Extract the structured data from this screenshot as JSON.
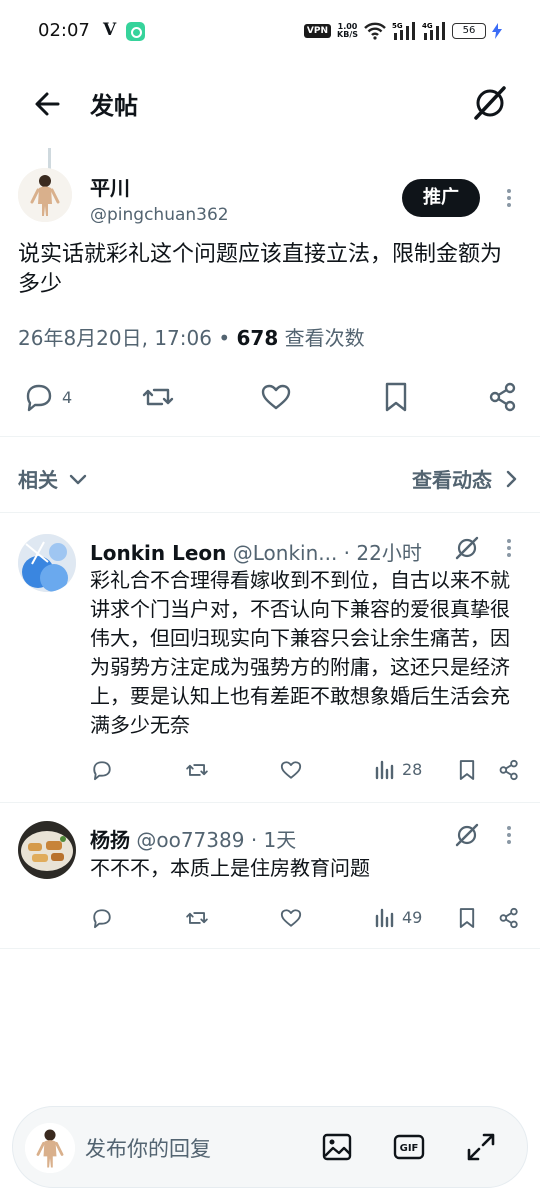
{
  "status_bar": {
    "time": "02:07",
    "carrier_mark": "V",
    "vpn": "VPN",
    "speed_value": "1.00",
    "speed_unit": "KB/S",
    "signal_1": "5G",
    "signal_2": "4G",
    "battery": "56"
  },
  "header": {
    "title": "发帖"
  },
  "post": {
    "author_name": "平川",
    "author_handle": "@pingchuan362",
    "promote_label": "推广",
    "text": "说实话就彩礼这个问题应该直接立法，限制金额为多少",
    "date": "26年8月20日, 17:06",
    "separator": " • ",
    "views": "678",
    "views_label": " 查看次数",
    "reply_count": "4"
  },
  "related": {
    "label": "相关",
    "view_activity": "查看动态"
  },
  "replies": [
    {
      "name": "Lonkin Leon",
      "handle": "@Lonkin...",
      "time": " · 22小时",
      "text": "彩礼合不合理得看嫁收到不到位，自古以来不就讲求个门当户对，不否认向下兼容的爱很真挚很伟大，但回归现实向下兼容只会让余生痛苦，因为弱势方注定成为强势方的附庸，这还只是经济上，要是认知上也有差距不敢想象婚后生活会充满多少无奈",
      "views": "28"
    },
    {
      "name": "杨扬",
      "handle": "@oo77389",
      "time": " · 1天",
      "text": "不不不，本质上是住房教育问题",
      "views": "49"
    }
  ],
  "composer": {
    "placeholder": "发布你的回复"
  },
  "colors": {
    "text": "#0f1419",
    "secondary": "#536471",
    "divider": "#eff3f4",
    "button_dark": "#0f1419"
  }
}
